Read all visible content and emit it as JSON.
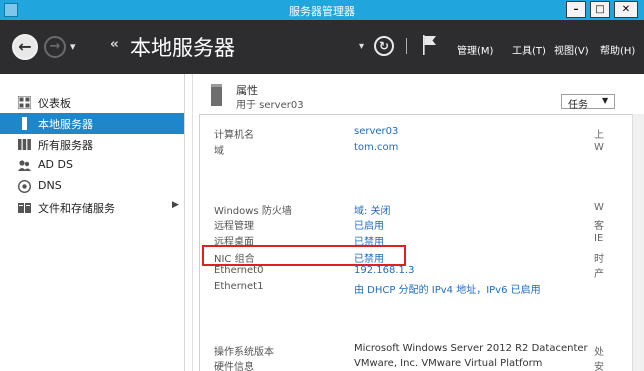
{
  "window": {
    "title": "服务器管理器",
    "min_label": "–",
    "max_label": "□",
    "close_label": "✕"
  },
  "header": {
    "back_glyph": "←",
    "forward_glyph": "→",
    "nav_dropdown_glyph": "▾",
    "breadcrumb_glyph": "‹‹",
    "page_title": "本地服务器",
    "dropdown_glyph": "▾",
    "refresh_glyph": "↻",
    "menu": [
      "管理(M)",
      "工具(T)",
      "视图(V)",
      "帮助(H)"
    ]
  },
  "sidebar": {
    "items": [
      {
        "label": "仪表板",
        "icon": "dashboard-icon",
        "active": false
      },
      {
        "label": "本地服务器",
        "icon": "local-server-icon",
        "active": true
      },
      {
        "label": "所有服务器",
        "icon": "all-servers-icon",
        "active": false
      },
      {
        "label": "AD DS",
        "icon": "ad-ds-icon",
        "active": false
      },
      {
        "label": "DNS",
        "icon": "dns-icon",
        "active": false
      },
      {
        "label": "文件和存储服务",
        "icon": "file-storage-icon",
        "active": false,
        "expand_glyph": "▶"
      }
    ]
  },
  "properties": {
    "title": "属性",
    "subtitle": "用于 server03",
    "tasks_label": "任务",
    "tasks_caret": "▼",
    "rows": [
      {
        "key": "计算机名",
        "value": "server03",
        "right": "上"
      },
      {
        "key": "域",
        "value": "tom.com",
        "right": "W"
      },
      {
        "key": "Windows 防火墙",
        "value": "域: 关闭",
        "right": "W"
      },
      {
        "key": "远程管理",
        "value": "已启用",
        "right": "客"
      },
      {
        "key": "远程桌面",
        "value": "已禁用",
        "right": "IE"
      },
      {
        "key": "NIC 组合",
        "value": "已禁用",
        "right": "时"
      },
      {
        "key": "Ethernet0",
        "value": "192.168.1.3",
        "right": "产"
      },
      {
        "key": "Ethernet1",
        "value": "由 DHCP 分配的 IPv4 地址，IPv6 已启用",
        "right": ""
      },
      {
        "key": "操作系统版本",
        "value": "Microsoft Windows Server 2012 R2 Datacenter",
        "right": "处"
      },
      {
        "key": "硬件信息",
        "value": "VMware, Inc. VMware Virtual Platform",
        "right": "安"
      }
    ]
  },
  "colors": {
    "titlebar": "#20a6dc",
    "header": "#2d2d30",
    "active_item": "#1e86c9",
    "link": "#1f6cbf",
    "highlight_box": "#e02020"
  }
}
